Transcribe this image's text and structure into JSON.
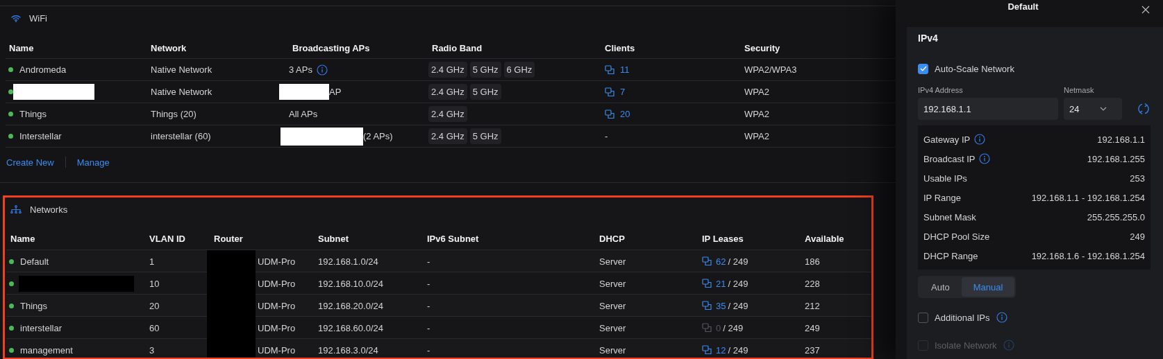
{
  "wifi": {
    "title": "WiFi",
    "columns": [
      "Name",
      "Network",
      "Broadcasting APs",
      "Radio Band",
      "Clients",
      "Security"
    ],
    "rows": [
      {
        "name": "Andromeda",
        "redacted": false,
        "network": "Native Network",
        "aps": {
          "text": "3 APs",
          "redacted": false,
          "info": true
        },
        "bands": [
          "2.4 GHz",
          "5 GHz",
          "6 GHz"
        ],
        "clients": {
          "count": "11",
          "icon": true
        },
        "security": "WPA2/WPA3"
      },
      {
        "redacted": true,
        "network": "Native Network",
        "aps": {
          "text": "AP",
          "redacted": true,
          "info": false
        },
        "bands": [
          "2.4 GHz",
          "5 GHz"
        ],
        "clients": {
          "count": "7",
          "icon": true
        },
        "security": "WPA2"
      },
      {
        "name": "Things",
        "redacted": false,
        "network": "Things (20)",
        "aps": {
          "text": "All APs",
          "redacted": false,
          "info": false
        },
        "bands": [
          "2.4 GHz"
        ],
        "clients": {
          "count": "20",
          "icon": true
        },
        "security": "WPA2"
      },
      {
        "name": "Interstellar",
        "redacted": false,
        "network": "interstellar (60)",
        "aps": {
          "text": "(2 APs)",
          "redacted": true,
          "info": false
        },
        "bands": [
          "2.4 GHz",
          "5 GHz"
        ],
        "clients": {
          "count": "-",
          "icon": false
        },
        "security": "WPA2"
      }
    ],
    "actions": [
      "Create New",
      "Manage"
    ]
  },
  "networks": {
    "title": "Networks",
    "highlighted": true,
    "columns": [
      "Name",
      "VLAN ID",
      "Router",
      "Subnet",
      "IPv6 Subnet",
      "DHCP",
      "IP Leases",
      "Available"
    ],
    "rows": [
      {
        "name": "Default",
        "redacted": false,
        "vlan": "1",
        "router": "UDM-Pro",
        "subnet": "192.168.1.0/24",
        "ipv6": "-",
        "dhcp": "Server",
        "leases": {
          "used": "62",
          "total": "/ 249",
          "active": true
        },
        "available": "186"
      },
      {
        "redacted": true,
        "vlan": "10",
        "router": "UDM-Pro",
        "subnet": "192.168.10.0/24",
        "ipv6": "-",
        "dhcp": "Server",
        "leases": {
          "used": "21",
          "total": "/ 249",
          "active": true
        },
        "available": "228"
      },
      {
        "name": "Things",
        "redacted": false,
        "vlan": "20",
        "router": "UDM-Pro",
        "subnet": "192.168.20.0/24",
        "ipv6": "-",
        "dhcp": "Server",
        "leases": {
          "used": "35",
          "total": "/ 249",
          "active": true
        },
        "available": "212"
      },
      {
        "name": "interstellar",
        "redacted": false,
        "vlan": "60",
        "router": "UDM-Pro",
        "subnet": "192.168.60.0/24",
        "ipv6": "-",
        "dhcp": "Server",
        "leases": {
          "used": "0",
          "total": "/ 249",
          "active": false
        },
        "available": "249"
      },
      {
        "name": "management",
        "redacted": false,
        "vlan": "3",
        "router": "UDM-Pro",
        "subnet": "192.168.3.0/24",
        "ipv6": "-",
        "dhcp": "Server",
        "leases": {
          "used": "12",
          "total": "/ 249",
          "active": true
        },
        "available": "237"
      }
    ]
  },
  "panel": {
    "title": "Default",
    "section": "IPv4",
    "auto_scale": {
      "label": "Auto-Scale Network",
      "checked": true
    },
    "address": {
      "label": "IPv4 Address",
      "value": "192.168.1.1"
    },
    "netmask": {
      "label": "Netmask",
      "value": "24"
    },
    "info": [
      {
        "label": "Gateway IP",
        "info": true,
        "value": "192.168.1.1"
      },
      {
        "label": "Broadcast IP",
        "info": true,
        "value": "192.168.1.255"
      },
      {
        "label": "Usable IPs",
        "info": false,
        "value": "253"
      },
      {
        "label": "IP Range",
        "info": false,
        "value": "192.168.1.1 - 192.168.1.254"
      },
      {
        "label": "Subnet Mask",
        "info": false,
        "value": "255.255.255.0"
      },
      {
        "label": "DHCP Pool Size",
        "info": false,
        "value": "249"
      },
      {
        "label": "DHCP Range",
        "info": false,
        "value": "192.168.1.6 - 192.168.1.254"
      }
    ],
    "modes": [
      {
        "label": "Auto",
        "selected": false
      },
      {
        "label": "Manual",
        "selected": true
      }
    ],
    "options": [
      {
        "label": "Additional IPs",
        "checked": false,
        "disabled": false,
        "info": true
      },
      {
        "label": "Isolate Network",
        "checked": false,
        "disabled": true,
        "info": true
      }
    ]
  }
}
